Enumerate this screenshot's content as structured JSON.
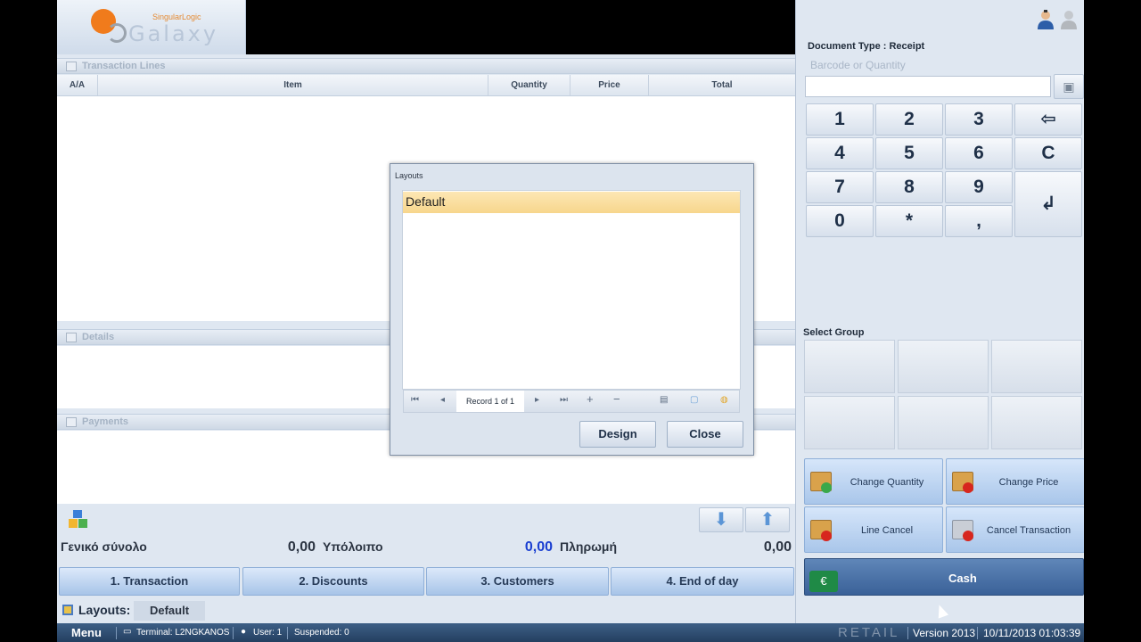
{
  "logo": {
    "brand": "SingularLogic",
    "product": "Galaxy"
  },
  "transaction_lines": {
    "title": "Transaction Lines",
    "columns": [
      "A/A",
      "Item",
      "Quantity",
      "Price",
      "Total"
    ]
  },
  "details": {
    "title": "Details"
  },
  "payments": {
    "title": "Payments"
  },
  "totals": {
    "grand_total_label": "Γενικό σύνολο",
    "grand_total_value": "0,00",
    "balance_label": "Υπόλοιπο",
    "balance_value": "0,00",
    "payment_label": "Πληρωμή",
    "payment_value": "0,00"
  },
  "tabs": [
    "1. Transaction",
    "2. Discounts",
    "3. Customers",
    "4.  End of day"
  ],
  "layouts_bar": {
    "label": "Layouts:",
    "value": "Default"
  },
  "status_bar": {
    "menu": "Menu",
    "terminal": "Terminal: L2NGKANOS",
    "user": "User: 1",
    "suspended": "Suspended: 0",
    "retail": "RETAIL",
    "version": "Version 2013",
    "datetime": "10/11/2013 01:03:39"
  },
  "right_panel": {
    "document_type": "Document Type : Receipt",
    "barcode_placeholder": "Barcode or Quantity",
    "barcode_value": "",
    "keypad": [
      "1",
      "2",
      "3",
      "⇦",
      "4",
      "5",
      "6",
      "C",
      "7",
      "8",
      "9",
      "↲",
      "0",
      "*",
      ","
    ],
    "select_group_label": "Select Group",
    "actions": {
      "change_quantity": "Change Quantity",
      "change_price": "Change Price",
      "line_cancel": "Line Cancel",
      "cancel_transaction": "Cancel Transaction",
      "cash": "Cash",
      "cash_icon_glyph": "€"
    }
  },
  "dialog": {
    "title": "Layouts",
    "items": [
      "Default"
    ],
    "record_text": "Record 1 of 1",
    "design_label": "Design",
    "close_label": "Close"
  },
  "colors": {
    "accent": "#3a6198",
    "balance_value": "#1a3fd1",
    "selected_row": "#f7d68c"
  }
}
